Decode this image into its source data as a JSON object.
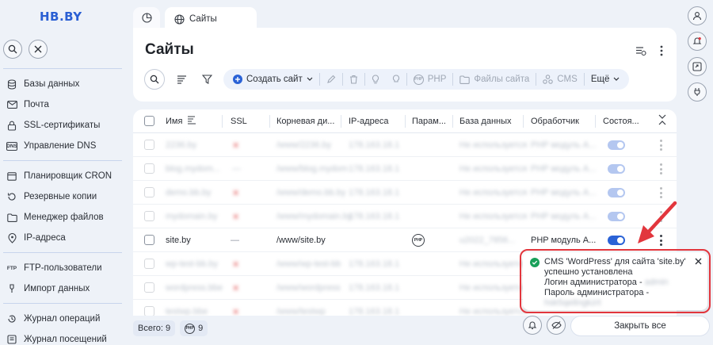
{
  "brand": {
    "logo": "HB.BY"
  },
  "sidebar": {
    "items": [
      {
        "label": "Базы данных",
        "icon": "database-icon"
      },
      {
        "label": "Почта",
        "icon": "mail-icon"
      },
      {
        "label": "SSL-сертификаты",
        "icon": "certificate-icon"
      },
      {
        "label": "Управление DNS",
        "icon": "dns-icon"
      },
      {
        "label": "Планировщик CRON",
        "icon": "calendar-icon"
      },
      {
        "label": "Резервные копии",
        "icon": "backup-icon"
      },
      {
        "label": "Менеджер файлов",
        "icon": "folder-icon"
      },
      {
        "label": "IP-адреса",
        "icon": "location-icon"
      },
      {
        "label": "FTP-пользователи",
        "icon": "ftp-icon"
      },
      {
        "label": "Импорт данных",
        "icon": "import-icon"
      },
      {
        "label": "Журнал операций",
        "icon": "log-icon"
      },
      {
        "label": "Журнал посещений",
        "icon": "visits-icon"
      }
    ]
  },
  "tabs": {
    "active": "Сайты"
  },
  "page": {
    "title": "Сайты"
  },
  "toolbar": {
    "create_site": "Создать сайт",
    "php": "PHP",
    "site_files": "Файлы сайта",
    "cms": "CMS",
    "more": "Ещё"
  },
  "table": {
    "columns": [
      "Имя",
      "SSL",
      "Корневая ди...",
      "IP-адреса",
      "Парам...",
      "База данных",
      "Обработчик",
      "Состоя..."
    ],
    "blurred_rows": [
      {
        "name": "2236.by",
        "ssl": "✕",
        "root": "/www/2236.by",
        "ip": "178.163.18.1",
        "db": "Не используется",
        "handler": "PHP модуль A..."
      },
      {
        "name": "blog.mydom...",
        "ssl": "—",
        "root": "/www/blog.mydom",
        "ip": "178.163.18.1",
        "db": "Не используется",
        "handler": "PHP модуль A..."
      },
      {
        "name": "demo.bb.by",
        "ssl": "✕",
        "root": "/www/demo.bb.by",
        "ip": "178.163.18.1",
        "db": "Не используется",
        "handler": "PHP модуль A..."
      },
      {
        "name": "mydomain.by",
        "ssl": "✕",
        "root": "/www/mydomain.by",
        "ip": "178.163.18.1",
        "db": "Не используется",
        "handler": "PHP модуль A..."
      }
    ],
    "site_row": {
      "name": "site.by",
      "ssl": "—",
      "root": "/www/site.by",
      "param": "PHP",
      "db": "u2022_7856...",
      "handler": "PHP модуль A..."
    },
    "blurred_rows_after": [
      {
        "name": "wp-test-bb.by",
        "ssl": "✕",
        "root": "/www/wp-test-bb",
        "ip": "178.163.18.1",
        "db": "Не используется"
      },
      {
        "name": "wordpress.bbe",
        "ssl": "✕",
        "root": "/www/wordpress",
        "ip": "178.163.18.1",
        "db": "Не используется"
      },
      {
        "name": "testwp.bbe",
        "ssl": "✕",
        "root": "/www/testwp",
        "ip": "178.163.18.1",
        "db": "Не используется"
      }
    ]
  },
  "footer": {
    "total": "Всего: 9",
    "php_count": "9"
  },
  "notification": {
    "line1": "CMS 'WordPress' для сайта 'site.by'",
    "line2": "успешно установлена",
    "line3_label": "Логин администратора -",
    "line3_value": "admin",
    "line4_label": "Пароль администратора -",
    "line4_value": "hsk5qe8ngkzrt"
  },
  "close_all": "Закрыть все",
  "colors": {
    "accent": "#2a62d6",
    "highlight": "#e2363d",
    "success": "#19a05a"
  }
}
